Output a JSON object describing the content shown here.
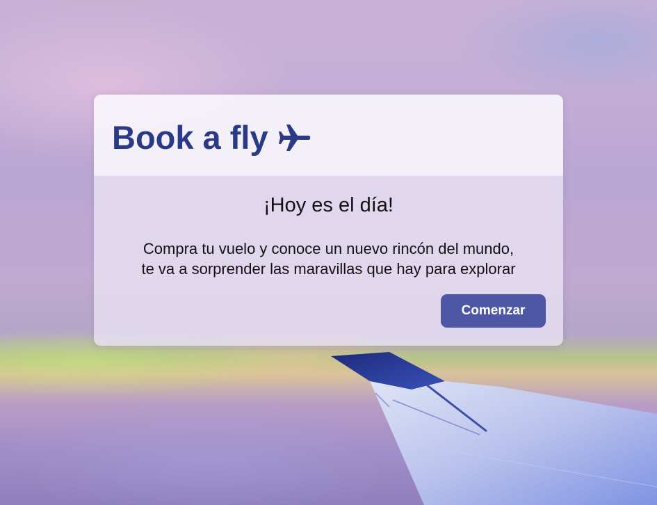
{
  "header": {
    "brand_title": "Book a fly",
    "brand_icon": "airplane-icon"
  },
  "hero": {
    "headline": "¡Hoy es el día!",
    "description_line1": "Compra tu vuelo y conoce un nuevo rincón del mundo,",
    "description_line2": "te va a sorprender las maravillas que hay para explorar",
    "cta_label": "Comenzar"
  },
  "colors": {
    "brand": "#2b3a86",
    "button": "#4e56a6",
    "button_text": "#ffffff"
  }
}
